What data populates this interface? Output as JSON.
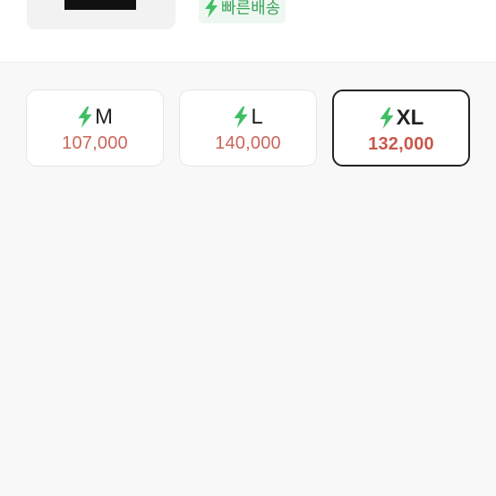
{
  "product": {
    "fast_delivery_label": "빠른배송"
  },
  "size_options": [
    {
      "size": "M",
      "price": "107,000",
      "icon": "lightning-bolt-icon",
      "selected": false
    },
    {
      "size": "L",
      "price": "140,000",
      "icon": "lightning-bolt-icon",
      "selected": false
    },
    {
      "size": "XL",
      "price": "132,000",
      "icon": "lightning-bolt-icon",
      "selected": true
    }
  ],
  "colors": {
    "bolt_green": "#3fbf63",
    "price_red": "#c9665a",
    "selected_border": "#222222",
    "badge_bg": "#eef8f1",
    "badge_text": "#3aa35b"
  }
}
